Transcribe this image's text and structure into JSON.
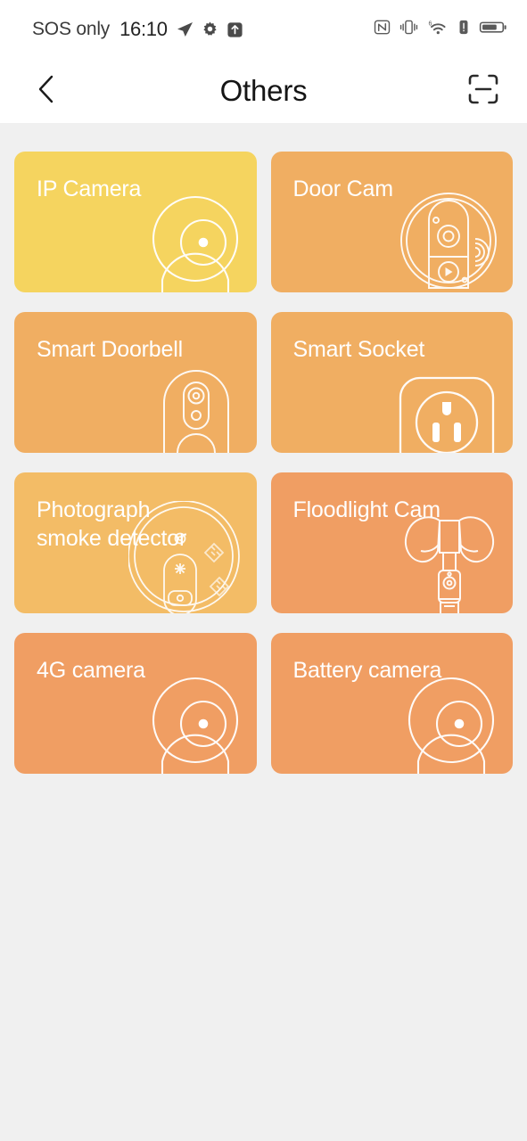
{
  "status_bar": {
    "carrier": "SOS only",
    "time": "16:10",
    "left_icons": [
      "location-arrow-icon",
      "gear-icon",
      "upload-box-icon"
    ],
    "right_icons": [
      "nfc-icon",
      "vibrate-icon",
      "wifi-6-icon",
      "signal-warning-icon",
      "battery-icon"
    ]
  },
  "header": {
    "back_icon": "chevron-left-icon",
    "title": "Others",
    "scan_icon": "scan-frame-icon"
  },
  "colors": {
    "page_background": "#f0f0f0",
    "bar_background": "#ffffff",
    "title_text": "#151515",
    "card_text": "#ffffff",
    "yellow": "#f5d45f",
    "amber": "#f3bc66",
    "orange": "#f0ae62",
    "salmon": "#f09e63",
    "art_stroke": "#ffffff"
  },
  "grid": {
    "cards": [
      {
        "label": "IP Camera",
        "color": "#f5d45f",
        "art": "camera-icon",
        "name": "card-ip-camera"
      },
      {
        "label": "Door Cam",
        "color": "#f0ae62",
        "art": "door-cam-icon",
        "name": "card-door-cam"
      },
      {
        "label": "Smart Doorbell",
        "color": "#f0ae62",
        "art": "doorbell-icon",
        "name": "card-smart-doorbell"
      },
      {
        "label": "Smart Socket",
        "color": "#f0ae62",
        "art": "socket-icon",
        "name": "card-smart-socket"
      },
      {
        "label": "Photograph\nsmoke detector",
        "color": "#f3bc66",
        "art": "smoke-detector-icon",
        "name": "card-photograph-smoke-detector"
      },
      {
        "label": "Floodlight Cam",
        "color": "#f09e63",
        "art": "floodlight-icon",
        "name": "card-floodlight-cam"
      },
      {
        "label": "4G camera",
        "color": "#f09e63",
        "art": "camera-icon",
        "name": "card-4g-camera"
      },
      {
        "label": "Battery camera",
        "color": "#f09e63",
        "art": "camera-icon",
        "name": "card-battery-camera"
      }
    ]
  }
}
